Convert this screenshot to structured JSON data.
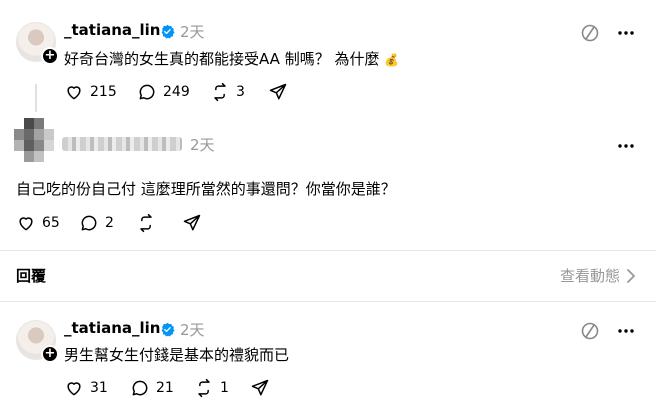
{
  "post1": {
    "username": "_tatiana_lin",
    "time": "2天",
    "text": "好奇台灣的女生真的都能接受AA 制嗎？ 為什麼",
    "emoji": "💰",
    "likes": "215",
    "comments": "249",
    "reposts": "3"
  },
  "post2": {
    "time": "2天",
    "text": "自己吃的份自己付 這麼理所當然的事還問？你當你是誰？",
    "likes": "65",
    "comments": "2"
  },
  "reply_bar": {
    "label": "回覆",
    "activity": "查看動態"
  },
  "post3": {
    "username": "_tatiana_lin",
    "time": "2天",
    "text": "男生幫女生付錢是基本的禮貌而已",
    "likes": "31",
    "comments": "21",
    "reposts": "1"
  },
  "colors": {
    "verified": "#0095f6",
    "muted": "#999999",
    "divider": "#e6e6e6"
  }
}
